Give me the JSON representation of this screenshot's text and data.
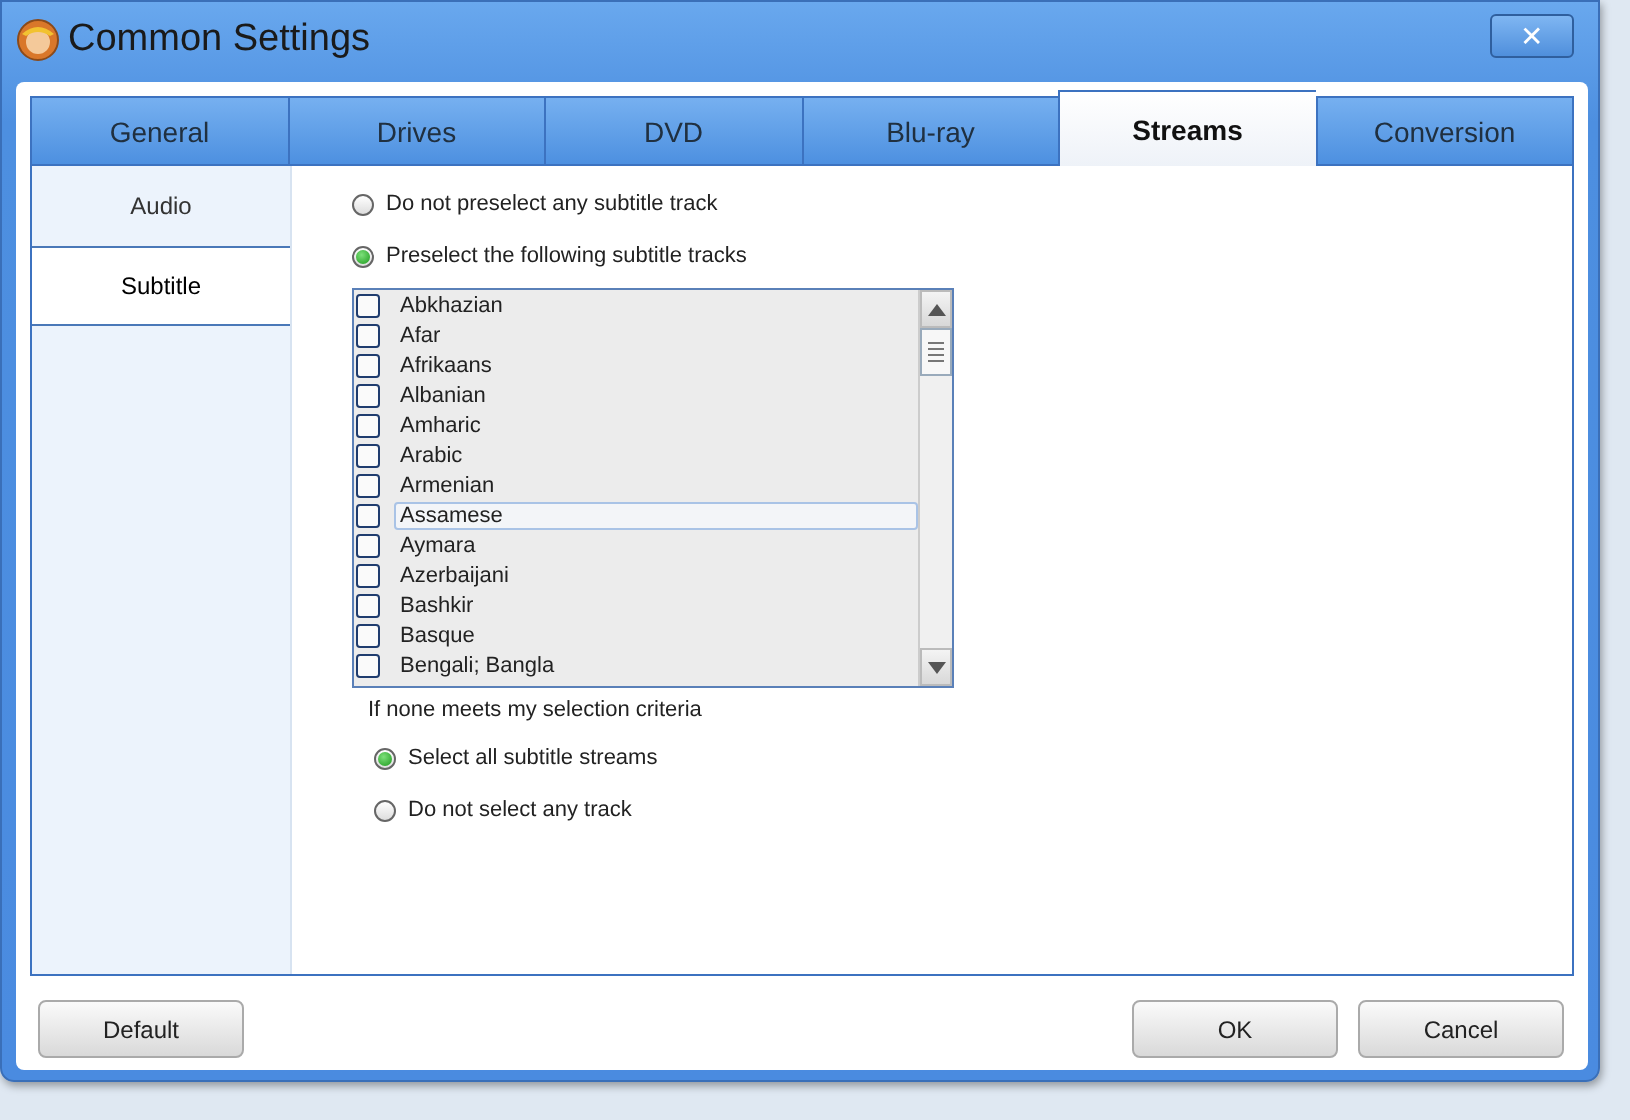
{
  "window": {
    "title": "Common Settings",
    "close": "✕"
  },
  "tabs": [
    {
      "label": "General",
      "selected": false
    },
    {
      "label": "Drives",
      "selected": false
    },
    {
      "label": "DVD",
      "selected": false
    },
    {
      "label": "Blu-ray",
      "selected": false
    },
    {
      "label": "Streams",
      "selected": true
    },
    {
      "label": "Conversion",
      "selected": false
    }
  ],
  "sidebar": {
    "items": [
      {
        "label": "Audio",
        "selected": false
      },
      {
        "label": "Subtitle",
        "selected": true
      }
    ]
  },
  "preselect_options": [
    {
      "label": "Do not preselect any subtitle track",
      "selected": false
    },
    {
      "label": "Preselect the following subtitle tracks",
      "selected": true
    }
  ],
  "tracks": [
    {
      "label": "Abkhazian",
      "checked": false,
      "highlighted": false
    },
    {
      "label": "Afar",
      "checked": false,
      "highlighted": false
    },
    {
      "label": "Afrikaans",
      "checked": false,
      "highlighted": false
    },
    {
      "label": "Albanian",
      "checked": false,
      "highlighted": false
    },
    {
      "label": "Amharic",
      "checked": false,
      "highlighted": false
    },
    {
      "label": "Arabic",
      "checked": false,
      "highlighted": false
    },
    {
      "label": "Armenian",
      "checked": false,
      "highlighted": false
    },
    {
      "label": "Assamese",
      "checked": false,
      "highlighted": true
    },
    {
      "label": "Aymara",
      "checked": false,
      "highlighted": false
    },
    {
      "label": "Azerbaijani",
      "checked": false,
      "highlighted": false
    },
    {
      "label": "Bashkir",
      "checked": false,
      "highlighted": false
    },
    {
      "label": "Basque",
      "checked": false,
      "highlighted": false
    },
    {
      "label": "Bengali; Bangla",
      "checked": false,
      "highlighted": false
    }
  ],
  "fallback": {
    "label": "If none meets my selection criteria",
    "options": [
      {
        "label": "Select all subtitle streams",
        "selected": true
      },
      {
        "label": "Do not select any track",
        "selected": false
      }
    ]
  },
  "buttons": [
    {
      "label": "Default",
      "kind": "left"
    },
    {
      "label": "OK",
      "kind": "right"
    },
    {
      "label": "Cancel",
      "kind": "right"
    }
  ]
}
